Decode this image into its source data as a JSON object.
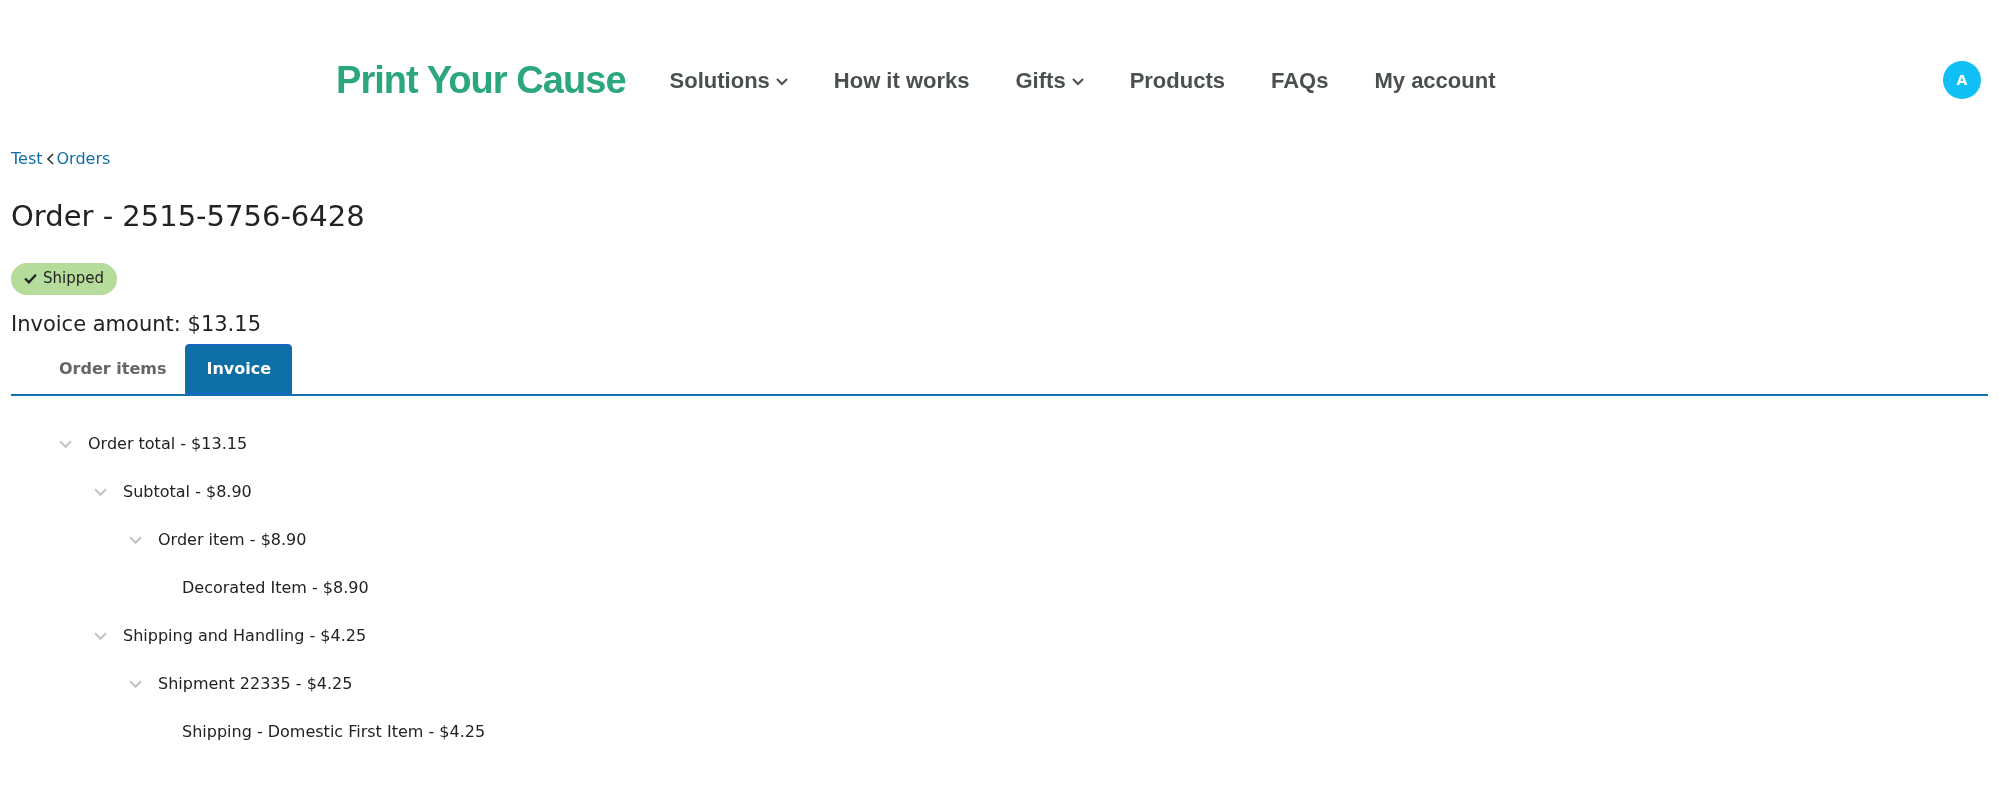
{
  "header": {
    "logo": "Print Your Cause",
    "nav": [
      {
        "label": "Solutions",
        "dropdown": true
      },
      {
        "label": "How it works",
        "dropdown": false
      },
      {
        "label": "Gifts",
        "dropdown": true
      },
      {
        "label": "Products",
        "dropdown": false
      },
      {
        "label": "FAQs",
        "dropdown": false
      },
      {
        "label": "My account",
        "dropdown": false
      }
    ],
    "avatar": "A"
  },
  "breadcrumb": [
    "Test",
    "Orders"
  ],
  "title": "Order - 2515-5756-6428",
  "status": {
    "label": "Shipped",
    "done": true
  },
  "invoice_amount": "Invoice amount: $13.15",
  "tabs": [
    {
      "label": "Order items",
      "selected": false
    },
    {
      "label": "Invoice",
      "selected": true
    }
  ],
  "tree": [
    {
      "label": "Order total - $13.15",
      "expanded": true,
      "children": [
        {
          "label": "Subtotal - $8.90",
          "expanded": true,
          "children": [
            {
              "label": "Order item - $8.90",
              "expanded": true,
              "children": [
                {
                  "label": "Decorated Item - $8.90"
                }
              ]
            }
          ]
        },
        {
          "label": "Shipping and Handling - $4.25",
          "expanded": true,
          "children": [
            {
              "label": "Shipment 22335 - $4.25",
              "expanded": true,
              "children": [
                {
                  "label": "Shipping - Domestic First Item - $4.25"
                }
              ]
            }
          ]
        }
      ]
    }
  ]
}
